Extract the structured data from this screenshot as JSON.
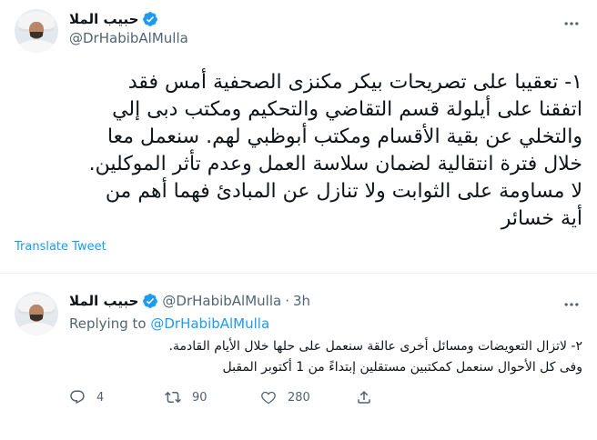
{
  "main_tweet": {
    "display_name": "حبيب الملا",
    "handle": "@DrHabibAlMulla",
    "text": "١- تعقيبا على تصريحات بيكر مكنزى الصحفية أمس فقد\nاتفقنا على أيلولة قسم التقاضي والتحكيم ومكتب دبى إلي\nوالتخلي عن بقية الأقسام ومكتب أبوظبي لهم. سنعمل معا\nخلال فترة انتقالية لضمان سلاسة العمل وعدم تأثر الموكلين.\nلا مساومة على الثوابت ولا تنازل عن المبادئ فهما أهم من\nأية خسائر",
    "translate_label": "Translate Tweet"
  },
  "reply_tweet": {
    "display_name": "حبيب الملا",
    "handle": "@DrHabibAlMulla",
    "separator": "·",
    "time": "3h",
    "replying_prefix": "Replying to",
    "replying_mention": "@DrHabibAlMulla",
    "text": "٢- لاتزال التعويضات ومسائل أخرى عالقة سنعمل على حلها خلال الأيام القادمة.\nوفى كل الأحوال سنعمل كمكتبين مستقلين إبتداءً من 1 أكتوبر المقبل",
    "counts": {
      "replies": "4",
      "retweets": "90",
      "likes": "280"
    }
  },
  "icons": {
    "verified": "verified-badge-icon",
    "more": "more-options-icon",
    "reply": "reply-icon",
    "retweet": "retweet-icon",
    "like": "heart-icon",
    "share": "share-icon"
  },
  "colors": {
    "accent": "#1d9bf0",
    "secondary_text": "#536471",
    "text": "#0f1419"
  }
}
